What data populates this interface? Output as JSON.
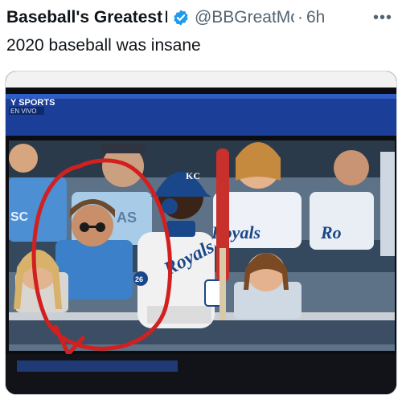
{
  "post": {
    "author_name": "Baseball's Greatest",
    "name_separator": "I",
    "handle": "@BBGreatMc",
    "separator": "·",
    "time": "6h",
    "more": "•••",
    "text": "2020 baseball was insane"
  },
  "media": {
    "network_logo": "Y SPORTS",
    "network_tag": "EN VIVO",
    "cutout_jersey_left": "SC",
    "cutout_jersey_mid": "AS",
    "cutout_jersey_right": "Royals",
    "cutout_jersey_far_right": "Ro",
    "player_jersey": "Royals",
    "player_number": "26",
    "helmet_logo": "KC"
  },
  "colors": {
    "verified_blue": "#1d9bf0",
    "royals_blue": "#1a4789",
    "annotation_red": "#d22020"
  },
  "icons": {
    "verified": "verified-badge-icon",
    "more": "more-options-icon"
  }
}
